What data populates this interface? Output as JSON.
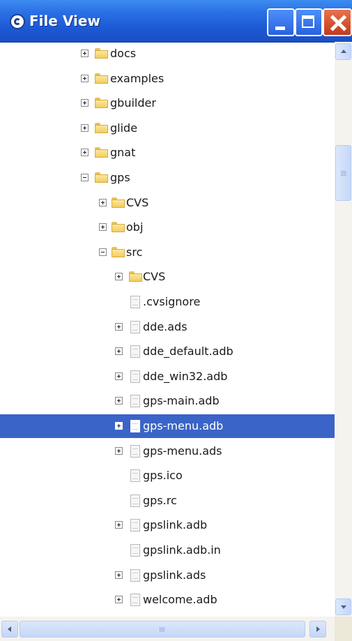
{
  "window": {
    "title": "File View",
    "app_icon": "gps-logo-icon",
    "buttons": [
      "minimize",
      "maximize",
      "close"
    ]
  },
  "tree": {
    "rows": [
      {
        "label": "docs",
        "type": "folder",
        "expander": "plus",
        "depth": 0
      },
      {
        "label": "examples",
        "type": "folder",
        "expander": "plus",
        "depth": 0
      },
      {
        "label": "gbuilder",
        "type": "folder",
        "expander": "plus",
        "depth": 0
      },
      {
        "label": "glide",
        "type": "folder",
        "expander": "plus",
        "depth": 0
      },
      {
        "label": "gnat",
        "type": "folder",
        "expander": "plus",
        "depth": 0
      },
      {
        "label": "gps",
        "type": "folder",
        "expander": "minus",
        "depth": 0
      },
      {
        "label": "CVS",
        "type": "folder",
        "expander": "plus",
        "depth": 1
      },
      {
        "label": "obj",
        "type": "folder",
        "expander": "plus",
        "depth": 1
      },
      {
        "label": "src",
        "type": "folder",
        "expander": "minus",
        "depth": 1
      },
      {
        "label": "CVS",
        "type": "folder",
        "expander": "plus",
        "depth": 2
      },
      {
        "label": ".cvsignore",
        "type": "file",
        "expander": "none",
        "depth": 2
      },
      {
        "label": "dde.ads",
        "type": "file",
        "expander": "plus",
        "depth": 2
      },
      {
        "label": "dde_default.adb",
        "type": "file",
        "expander": "plus",
        "depth": 2
      },
      {
        "label": "dde_win32.adb",
        "type": "file",
        "expander": "plus",
        "depth": 2
      },
      {
        "label": "gps-main.adb",
        "type": "file",
        "expander": "plus",
        "depth": 2
      },
      {
        "label": "gps-menu.adb",
        "type": "file",
        "expander": "plus",
        "depth": 2,
        "selected": true
      },
      {
        "label": "gps-menu.ads",
        "type": "file",
        "expander": "plus",
        "depth": 2
      },
      {
        "label": "gps.ico",
        "type": "file",
        "expander": "none",
        "depth": 2
      },
      {
        "label": "gps.rc",
        "type": "file",
        "expander": "none",
        "depth": 2
      },
      {
        "label": "gpslink.adb",
        "type": "file",
        "expander": "plus",
        "depth": 2
      },
      {
        "label": "gpslink.adb.in",
        "type": "file",
        "expander": "none",
        "depth": 2
      },
      {
        "label": "gpslink.ads",
        "type": "file",
        "expander": "plus",
        "depth": 2
      },
      {
        "label": "welcome.adb",
        "type": "file",
        "expander": "plus",
        "depth": 2
      }
    ]
  },
  "colors": {
    "titlebar": "#2a6fe4",
    "selection": "#3a64c7",
    "close_button": "#d9532f"
  }
}
